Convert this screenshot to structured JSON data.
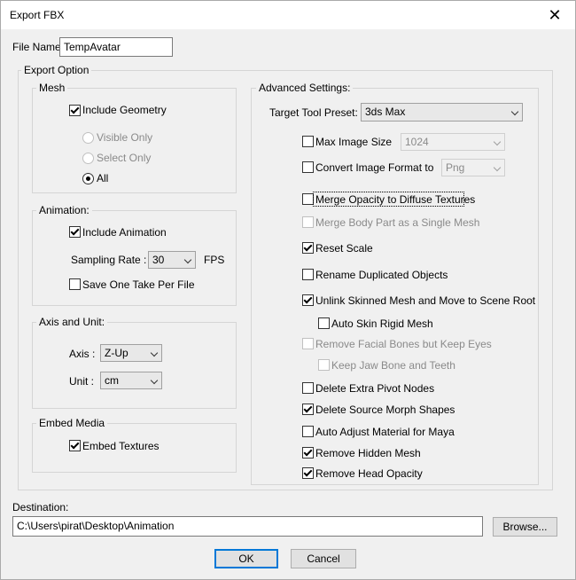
{
  "window": {
    "title": "Export FBX"
  },
  "file": {
    "label": "File Name:",
    "value": "TempAvatar"
  },
  "export_option": {
    "label": "Export Option"
  },
  "mesh": {
    "label": "Mesh",
    "include_geometry": "Include Geometry",
    "visible_only": "Visible Only",
    "select_only": "Select Only",
    "all": "All"
  },
  "animation": {
    "label": "Animation:",
    "include_animation": "Include Animation",
    "sampling_rate_label": "Sampling Rate :",
    "sampling_rate_value": "30",
    "fps": "FPS",
    "save_one_take": "Save One Take Per File"
  },
  "axis_unit": {
    "label": "Axis and Unit:",
    "axis_label": "Axis :",
    "axis_value": "Z-Up",
    "unit_label": "Unit :",
    "unit_value": "cm"
  },
  "embed_media": {
    "label": "Embed Media",
    "embed_textures": "Embed Textures"
  },
  "advanced": {
    "label": "Advanced Settings:",
    "target_preset_label": "Target Tool Preset:",
    "target_preset_value": "3ds Max",
    "max_image_size": "Max Image Size",
    "max_image_size_value": "1024",
    "convert_format": "Convert Image Format to",
    "convert_format_value": "Png",
    "merge_opacity": "Merge Opacity to Diffuse Textures",
    "merge_body": "Merge Body Part as a Single Mesh",
    "reset_scale": "Reset Scale",
    "rename_dup": "Rename Duplicated Objects",
    "unlink_skinned": "Unlink Skinned Mesh and Move to Scene Root",
    "auto_skin": "Auto Skin Rigid Mesh",
    "remove_facial": "Remove Facial Bones but Keep Eyes",
    "keep_jaw": "Keep Jaw Bone and Teeth",
    "delete_pivot": "Delete Extra Pivot Nodes",
    "delete_morph": "Delete Source Morph Shapes",
    "auto_adjust": "Auto Adjust Material for Maya",
    "remove_hidden": "Remove Hidden Mesh",
    "remove_head_opacity": "Remove Head Opacity"
  },
  "destination": {
    "label": "Destination:",
    "value": "C:\\Users\\pirat\\Desktop\\Animation",
    "browse": "Browse..."
  },
  "buttons": {
    "ok": "OK",
    "cancel": "Cancel"
  },
  "icons": {
    "close": "✕"
  }
}
